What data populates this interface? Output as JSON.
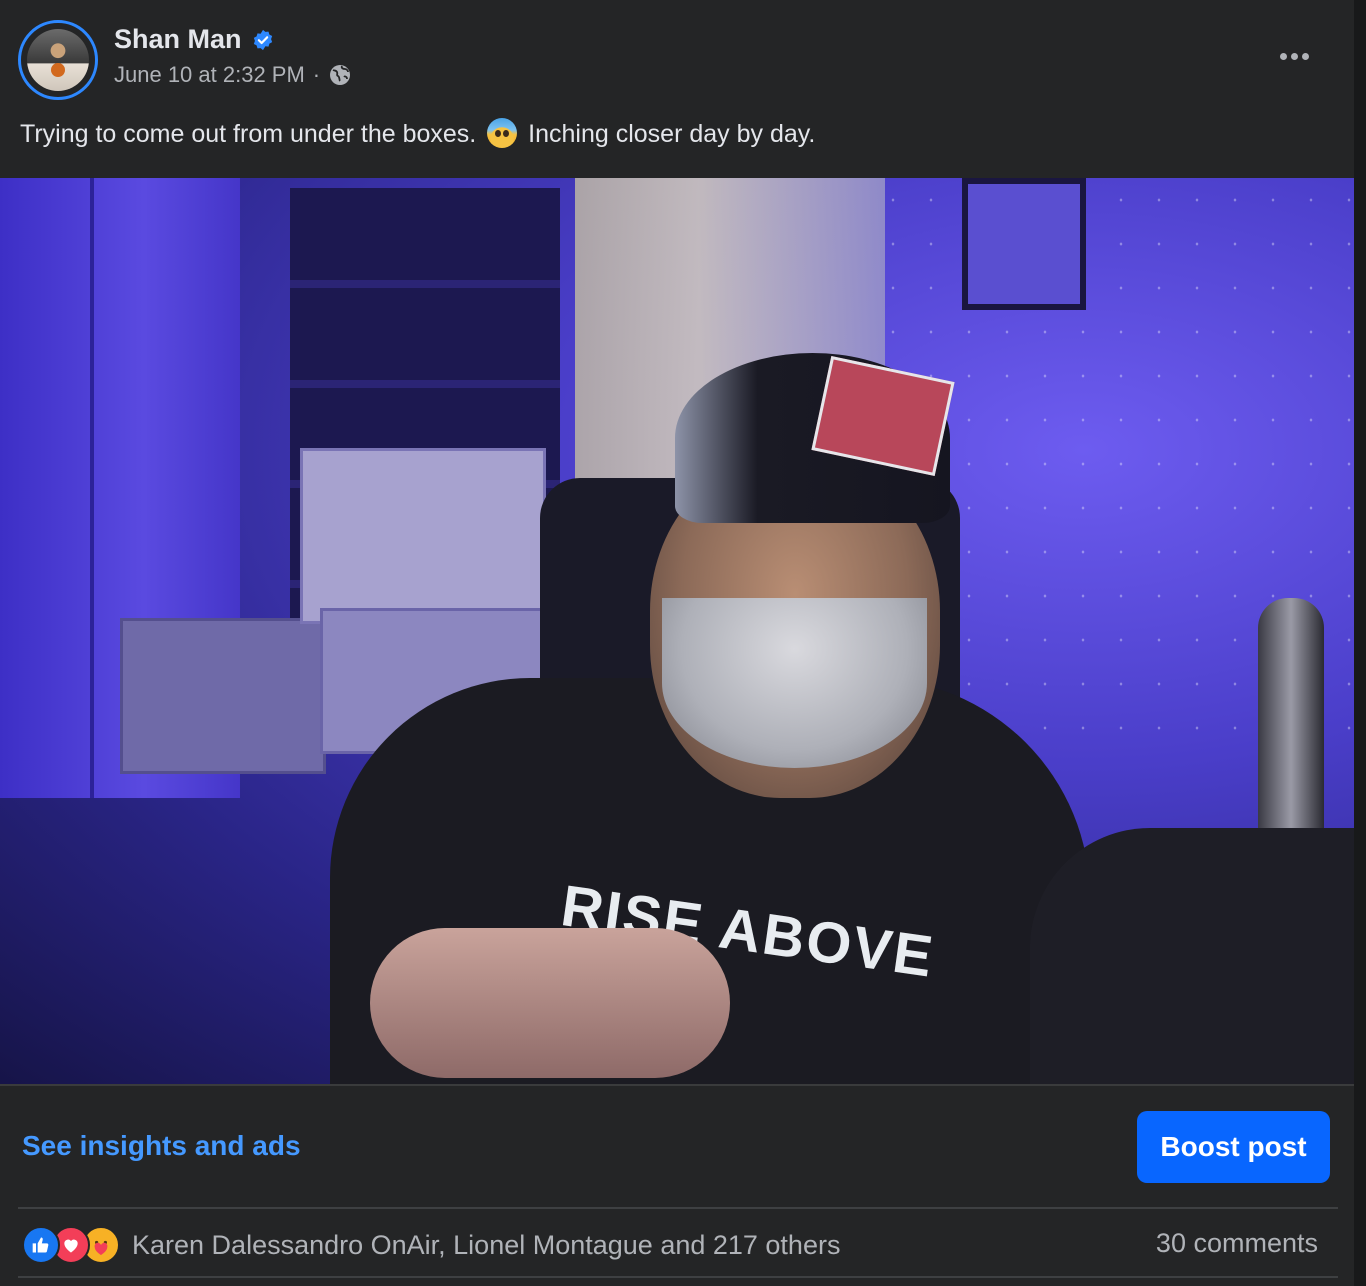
{
  "post": {
    "author": "Shan Man",
    "timestamp": "June 10 at 2:32 PM",
    "separator": "·",
    "audience_icon": "globe-icon",
    "caption_before": "Trying to come out from under the boxes.",
    "caption_after": "Inching closer day by day.",
    "caption_emoji": "anxious-face-with-sweat",
    "photo_shirt_text": "RISE ABOVE"
  },
  "footer": {
    "insights_label": "See insights and ads",
    "boost_label": "Boost post"
  },
  "engagement": {
    "reaction_icons": [
      "like-icon",
      "love-icon",
      "care-icon"
    ],
    "reactions_text": "Karen Dalessandro OnAir, Lionel Montague and 217 others",
    "comments_text": "30 comments"
  },
  "colors": {
    "background": "#242526",
    "primary_text": "#e4e6eb",
    "secondary_text": "#b0b3b8",
    "link": "#4599ff",
    "boost_button": "#0866ff",
    "verified_badge": "#2d88ff"
  }
}
